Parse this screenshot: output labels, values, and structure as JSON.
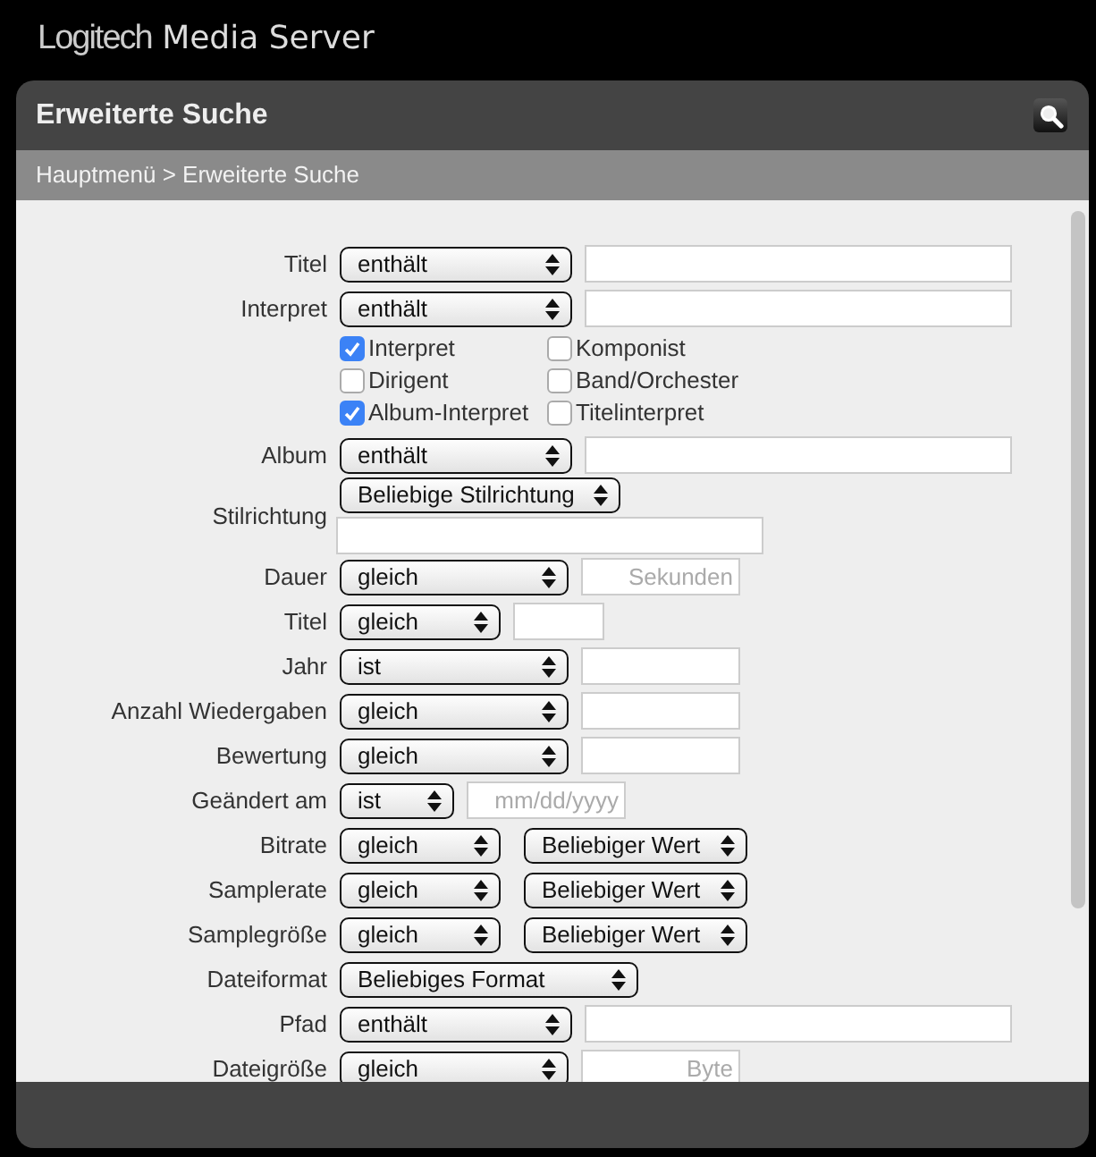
{
  "app_title": "**Logitech** Media Server",
  "panel": {
    "title": "Erweiterte Suche",
    "breadcrumb": "Hauptmenü > Erweiterte Suche"
  },
  "fields": [
    {
      "label": "Titel",
      "kind": "text",
      "controls": [
        {
          "kind": "select",
          "value": "enthält"
        },
        {
          "kind": "input"
        }
      ]
    },
    {
      "label": "Interpret",
      "kind": "text",
      "controls": [
        {
          "kind": "select",
          "value": "enthält"
        },
        {
          "kind": "input"
        }
      ],
      "options": [
        {
          "label": "Interpret",
          "checked": true
        },
        {
          "label": "Komponist",
          "checked": false
        },
        {
          "label": "Dirigent",
          "checked": false
        },
        {
          "label": "Band/Orchester",
          "checked": false
        },
        {
          "label": "Album-Interpret",
          "checked": true
        },
        {
          "label": "Titelinterpret",
          "checked": false
        }
      ]
    },
    {
      "label": "Album",
      "kind": "text",
      "controls": [
        {
          "kind": "select",
          "value": "enthält"
        },
        {
          "kind": "input"
        }
      ]
    },
    {
      "label": "Stilrichtung",
      "kind": "genre",
      "controls": [
        {
          "kind": "select",
          "value": "Beliebige Stilrichtung"
        },
        {
          "kind": "input"
        }
      ]
    },
    {
      "label": "Dauer",
      "kind": "number",
      "controls": [
        {
          "kind": "select",
          "value": "gleich"
        },
        {
          "kind": "input",
          "placeholder": "Sekunden"
        }
      ]
    },
    {
      "label": "Titel",
      "kind": "track",
      "controls": [
        {
          "kind": "select",
          "value": "gleich"
        },
        {
          "kind": "input"
        }
      ]
    },
    {
      "label": "Jahr",
      "kind": "number",
      "controls": [
        {
          "kind": "select",
          "value": "ist"
        },
        {
          "kind": "input"
        }
      ]
    },
    {
      "label": "Anzahl Wiedergaben",
      "kind": "number",
      "controls": [
        {
          "kind": "select",
          "value": "gleich"
        },
        {
          "kind": "input"
        }
      ]
    },
    {
      "label": "Bewertung",
      "kind": "number",
      "controls": [
        {
          "kind": "select",
          "value": "gleich"
        },
        {
          "kind": "input"
        }
      ]
    },
    {
      "label": "Geändert am",
      "kind": "date",
      "controls": [
        {
          "kind": "select",
          "value": "ist"
        },
        {
          "kind": "input",
          "placeholder": "mm/dd/yyyy"
        }
      ]
    },
    {
      "label": "Bitrate",
      "kind": "pair",
      "controls": [
        {
          "kind": "select",
          "value": "gleich"
        },
        {
          "kind": "select",
          "value": "Beliebiger Wert"
        }
      ]
    },
    {
      "label": "Samplerate",
      "kind": "pair",
      "controls": [
        {
          "kind": "select",
          "value": "gleich"
        },
        {
          "kind": "select",
          "value": "Beliebiger Wert"
        }
      ]
    },
    {
      "label": "Samplegröße",
      "kind": "pair",
      "controls": [
        {
          "kind": "select",
          "value": "gleich"
        },
        {
          "kind": "select",
          "value": "Beliebiger Wert"
        }
      ]
    },
    {
      "label": "Dateiformat",
      "kind": "format",
      "controls": [
        {
          "kind": "select",
          "value": "Beliebiges Format"
        }
      ]
    },
    {
      "label": "Pfad",
      "kind": "text",
      "controls": [
        {
          "kind": "select",
          "value": "enthält"
        },
        {
          "kind": "input"
        }
      ]
    },
    {
      "label": "Dateigröße",
      "kind": "number",
      "controls": [
        {
          "kind": "select",
          "value": "gleich"
        },
        {
          "kind": "input",
          "placeholder": "Byte"
        }
      ]
    }
  ]
}
